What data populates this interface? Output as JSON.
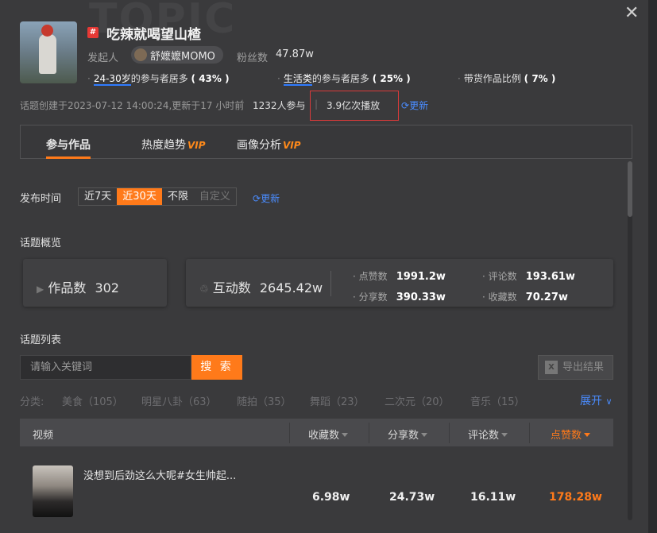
{
  "watermark": "TOPIC",
  "header": {
    "topic_tag": "#",
    "title": "吃辣就喝望山楂",
    "initiator_label": "发起人",
    "initiator_name": "舒嬷嬷MOMO",
    "fans_label": "粉丝数",
    "fans_value": "47.87w",
    "stats": [
      {
        "hl": "24-30岁",
        "rest": "的参与者居多",
        "pct": "( 43% )"
      },
      {
        "hl": "生活类",
        "rest": "的参与者居多",
        "pct": "( 25% )"
      },
      {
        "hl": "",
        "rest": "带货作品比例",
        "pct": "( 7% )"
      }
    ],
    "info_created": "话题创建于2023-07-12 14:00:24,更新于17 小时前",
    "info_participants": "1232人参与",
    "info_plays": "3.9亿次播放",
    "refresh_label": "更新"
  },
  "tabs": [
    {
      "label": "参与作品",
      "vip": ""
    },
    {
      "label": "热度趋势",
      "vip": "VIP"
    },
    {
      "label": "画像分析",
      "vip": "VIP"
    }
  ],
  "time_filter": {
    "label": "发布时间",
    "options": [
      "近7天",
      "近30天",
      "不限",
      "自定义"
    ],
    "selected": "近30天",
    "refresh_label": "更新"
  },
  "overview": {
    "title": "话题概览",
    "works_label": "作品数",
    "works_value": "302",
    "interact_label": "互动数",
    "interact_value": "2645.42w",
    "likes_label": "点赞数",
    "likes_value": "1991.2w",
    "comments_label": "评论数",
    "comments_value": "193.61w",
    "shares_label": "分享数",
    "shares_value": "390.33w",
    "collects_label": "收藏数",
    "collects_value": "70.27w"
  },
  "list": {
    "title": "话题列表",
    "search_placeholder": "请输入关键词",
    "search_button": "搜 索",
    "export_label": "导出结果",
    "category_label": "分类:",
    "categories": [
      "美食（105）",
      "明星八卦（63）",
      "随拍（35）",
      "舞蹈（23）",
      "二次元（20）",
      "音乐（15）"
    ],
    "expand_label": "展开",
    "columns": {
      "video": "视频",
      "collects": "收藏数",
      "shares": "分享数",
      "comments": "评论数",
      "likes": "点赞数"
    },
    "rows": [
      {
        "title": "没想到后劲这么大呢#女生帅起...",
        "collects": "6.98w",
        "shares": "24.73w",
        "comments": "16.11w",
        "likes": "178.28w"
      }
    ]
  },
  "colors": {
    "accent": "#ff7a1a",
    "link": "#4a8cff",
    "background": "#3a3a3c",
    "highlight_box": "#d93a3a"
  }
}
